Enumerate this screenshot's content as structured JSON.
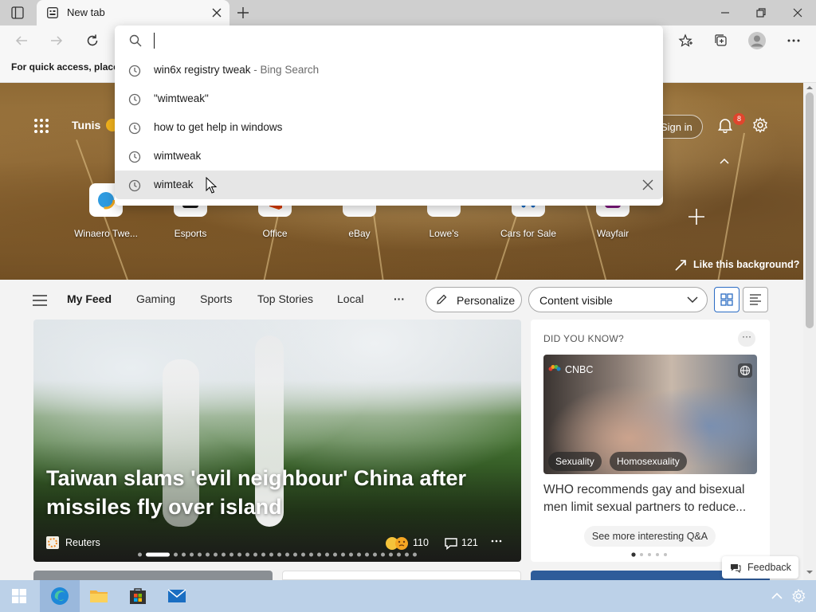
{
  "browser": {
    "tab_title": "New tab",
    "favorites_bar_text": "For quick access, place y"
  },
  "search": {
    "query": "",
    "suggestions": [
      {
        "text": "win6x registry tweak",
        "suffix": " - Bing Search"
      },
      {
        "text": "\"wimtweak\"",
        "suffix": ""
      },
      {
        "text": "how to get help in windows",
        "suffix": ""
      },
      {
        "text": "wimtweak",
        "suffix": ""
      },
      {
        "text": "wimteak",
        "suffix": ""
      }
    ]
  },
  "header": {
    "location": "Tunis",
    "sign_in": "Sign in",
    "notification_count": "8"
  },
  "quick_links": [
    {
      "label": "Winaero Twe...",
      "color": "#2f9be0"
    },
    {
      "label": "Esports",
      "color": "#c8102e"
    },
    {
      "label": "Office",
      "color": "#d83b01"
    },
    {
      "label": "eBay",
      "color": "#0064d2"
    },
    {
      "label": "Lowe's",
      "color": "#004990"
    },
    {
      "label": "Cars for Sale",
      "color": "#0a66c2"
    },
    {
      "label": "Wayfair",
      "color": "#7f187f"
    }
  ],
  "like_background": "Like this background?",
  "feed_nav": {
    "items": [
      "My Feed",
      "Gaming",
      "Sports",
      "Top Stories",
      "Local"
    ],
    "more": "···",
    "personalize": "Personalize",
    "content_visible": "Content visible"
  },
  "hero_article": {
    "title": "Taiwan slams 'evil neighbour' China after missiles fly over island",
    "source": "Reuters",
    "likes": "110",
    "comments": "121"
  },
  "did_you_know": {
    "title": "DID YOU KNOW?",
    "source": "CNBC",
    "tags": [
      "Sexuality",
      "Homosexuality"
    ],
    "headline": "WHO recommends gay and bisexual men limit sexual partners to reduce...",
    "see_more": "See more interesting Q&A"
  },
  "feedback": "Feedback",
  "colors": {
    "accent": "#2b6cc4",
    "taskbar": "#bcd1e8"
  }
}
